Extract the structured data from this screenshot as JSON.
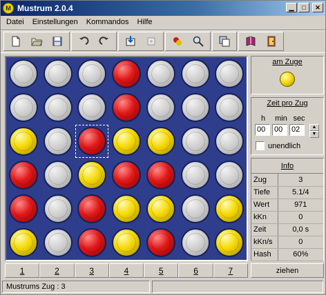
{
  "window": {
    "title": "Mustrum 2.0.4",
    "app_icon_letter": "M"
  },
  "menu": [
    "Datei",
    "Einstellungen",
    "Kommandos",
    "Hilfe"
  ],
  "toolbar": {
    "groups": [
      [
        "new-file-icon",
        "open-folder-icon",
        "save-disk-icon"
      ],
      [
        "undo-icon",
        "redo-icon"
      ],
      [
        "move-down-icon",
        "blank-icon"
      ],
      [
        "game-settings-icon",
        "search-icon"
      ],
      [
        "copy-windows-icon"
      ],
      [
        "book-icon",
        "exit-icon"
      ]
    ]
  },
  "board": {
    "rows": [
      [
        "empty",
        "empty",
        "empty",
        "red",
        "empty",
        "empty",
        "empty"
      ],
      [
        "empty",
        "empty",
        "empty",
        "red",
        "empty",
        "empty",
        "empty"
      ],
      [
        "yellow",
        "empty",
        "red",
        "yellow",
        "yellow",
        "empty",
        "empty"
      ],
      [
        "red",
        "empty",
        "yellow",
        "red",
        "red",
        "empty",
        "empty"
      ],
      [
        "red",
        "empty",
        "red",
        "yellow",
        "yellow",
        "empty",
        "yellow"
      ],
      [
        "yellow",
        "empty",
        "red",
        "yellow",
        "red",
        "empty",
        "yellow"
      ]
    ],
    "selected": {
      "row": 2,
      "col": 2
    },
    "columns": [
      "1",
      "2",
      "3",
      "4",
      "5",
      "6",
      "7"
    ]
  },
  "turn_panel": {
    "label": "am Zuge",
    "player_color": "yellow"
  },
  "time_panel": {
    "label": "Zeit pro Zug",
    "h_label": "h",
    "min_label": "min",
    "sec_label": "sec",
    "h": "00",
    "min": "00",
    "sec": "02",
    "unlimited_label": "unendlich",
    "unlimited_checked": false
  },
  "info_panel": {
    "label": "Info",
    "rows": [
      {
        "key": "Zug",
        "value": "3"
      },
      {
        "key": "Tiefe",
        "value": "5.1/4"
      },
      {
        "key": "Wert",
        "value": "971"
      },
      {
        "key": "kKn",
        "value": "0"
      },
      {
        "key": "Zeit",
        "value": "0,0 s"
      },
      {
        "key": "kKn/s",
        "value": "0"
      },
      {
        "key": "Hash",
        "value": "60%"
      }
    ]
  },
  "pull_button": "ziehen",
  "status": {
    "left": "Mustrums Zug :  3",
    "right": ""
  },
  "colors": {
    "board": "#2e3e8c",
    "red": "#e01818",
    "yellow": "#f5d800",
    "empty": "#c8c8c8"
  }
}
